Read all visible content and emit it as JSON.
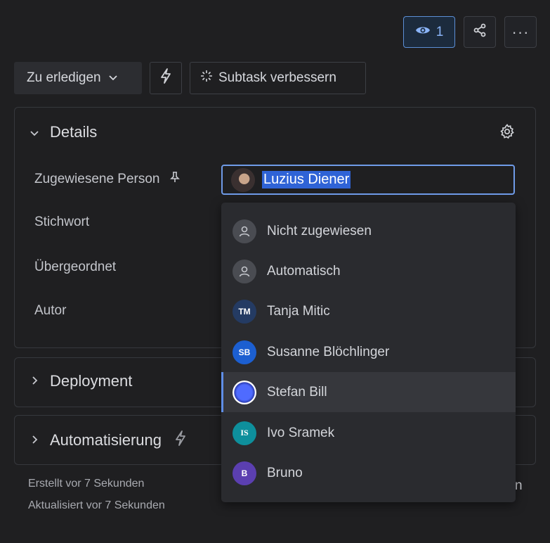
{
  "header": {
    "watch_count": "1",
    "more_label": "···"
  },
  "toolbar": {
    "status_label": "Zu erledigen",
    "improve_label": "Subtask verbessern"
  },
  "details": {
    "title": "Details",
    "fields": {
      "assignee_label": "Zugewiesene Person",
      "keyword_label": "Stichwort",
      "parent_label": "Übergeordnet",
      "author_label": "Autor"
    },
    "assignee_value": "Luzius Diener"
  },
  "dropdown": {
    "options": [
      {
        "label": "Nicht zugewiesen",
        "avatar": "user-icon",
        "initials": ""
      },
      {
        "label": "Automatisch",
        "avatar": "user-icon",
        "initials": ""
      },
      {
        "label": "Tanja Mitic",
        "avatar": "initials",
        "initials": "TM"
      },
      {
        "label": "Susanne Blöchlinger",
        "avatar": "initials",
        "initials": "SB"
      },
      {
        "label": "Stefan Bill",
        "avatar": "image",
        "initials": ""
      },
      {
        "label": "Ivo Sramek",
        "avatar": "initials",
        "initials": "IS"
      },
      {
        "label": "Bruno",
        "avatar": "initials",
        "initials": "B"
      }
    ],
    "highlighted": "Stefan Bill"
  },
  "sections": {
    "deployment": "Deployment",
    "automation": "Automatisierung"
  },
  "footer": {
    "created": "Erstellt vor 7 Sekunden",
    "updated": "Aktualisiert vor 7 Sekunden",
    "truncated_link": "n"
  },
  "colors": {
    "background": "#1f1f21",
    "accent": "#5f8ee6",
    "selection": "#2f63d6"
  }
}
